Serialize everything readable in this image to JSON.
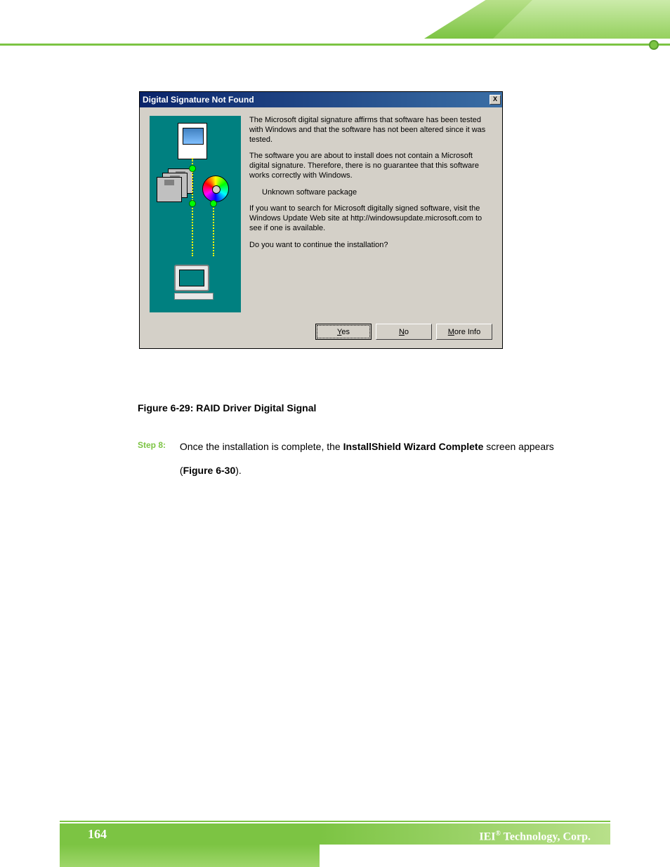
{
  "header": {},
  "dialog": {
    "title": "Digital Signature Not Found",
    "close": "X",
    "para1": "The Microsoft digital signature affirms that software has been tested with Windows and that the software has not been altered since it was tested.",
    "para2": "The software you are about to install does not contain a Microsoft digital signature. Therefore,  there is no guarantee that this software works correctly with Windows.",
    "package": "Unknown software package",
    "para3": "If you want to search for Microsoft digitally signed software, visit the Windows Update Web site at http://windowsupdate.microsoft.com to see if one is available.",
    "para4": "Do you want to continue the installation?",
    "buttons": {
      "yes_u": "Y",
      "yes_rest": "es",
      "no_u": "N",
      "no_rest": "o",
      "more_u": "M",
      "more_rest": "ore Info"
    }
  },
  "caption": "Figure 6-29: RAID Driver Digital Signal",
  "step": {
    "label": "Step 8:",
    "text_before": "Once the installation is complete, the ",
    "bold": "InstallShield Wizard Complete",
    "text_mid": " screen appears (",
    "figref": "Figure 6-30",
    "text_after": ")."
  },
  "footer": {
    "page": "164",
    "company_prefix": "IEI",
    "company_sup": "®",
    "company_suffix": " Technology, Corp."
  }
}
